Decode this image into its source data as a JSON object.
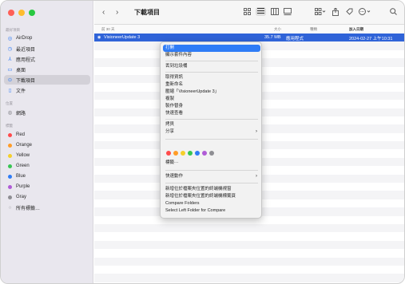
{
  "window": {
    "traffic_colors": [
      "#fe5f57",
      "#febc2e",
      "#28c840"
    ]
  },
  "sidebar": {
    "section_favorites": "最好項目",
    "favorites": [
      {
        "label": "AirDrop",
        "icon": "airdrop-icon",
        "glyph": "◎"
      },
      {
        "label": "最近項目",
        "icon": "clock-icon",
        "glyph": "◷"
      },
      {
        "label": "應用程式",
        "icon": "applications-icon",
        "glyph": "⅄"
      },
      {
        "label": "桌面",
        "icon": "desktop-icon",
        "glyph": "▭"
      },
      {
        "label": "下載項目",
        "icon": "downloads-icon",
        "glyph": "⊙"
      },
      {
        "label": "文件",
        "icon": "document-icon",
        "glyph": "▯"
      }
    ],
    "section_locations": "位置",
    "locations": [
      {
        "label": "網路",
        "icon": "network-icon",
        "glyph": "◍"
      }
    ],
    "section_tags": "標籤",
    "tags": [
      {
        "label": "Red",
        "color": "#ff4b4b"
      },
      {
        "label": "Orange",
        "color": "#ff9c27"
      },
      {
        "label": "Yellow",
        "color": "#f5cf2a"
      },
      {
        "label": "Green",
        "color": "#38c552"
      },
      {
        "label": "Blue",
        "color": "#2f7cf6"
      },
      {
        "label": "Purple",
        "color": "#b05bd6"
      },
      {
        "label": "Gray",
        "color": "#8e8e93"
      }
    ],
    "all_tags": "所有標籤…"
  },
  "toolbar": {
    "back": "‹",
    "forward": "›",
    "title": "下載項目"
  },
  "columns": {
    "group": "前 30 天",
    "size": "大小",
    "kind": "種類",
    "date_added": "加入日期"
  },
  "file": {
    "name": "VisioneerUpdate 3",
    "size": "35.7 MB",
    "kind": "應用程式",
    "date": "2024-02-27 上午10:31"
  },
  "context_menu": {
    "items": [
      {
        "label": "打開",
        "highlighted": true
      },
      {
        "label": "顯示套件內容"
      },
      {
        "label": "丟到垃圾桶"
      },
      {
        "label": "取得資訊"
      },
      {
        "label": "重新命名"
      },
      {
        "label": "壓縮「VisioneerUpdate 3」"
      },
      {
        "label": "複製"
      },
      {
        "label": "製作替身"
      },
      {
        "label": "快速查看"
      },
      {
        "label": "拷貝"
      },
      {
        "label": "分享",
        "submenu": true
      },
      {
        "label": "標籤⋯"
      },
      {
        "label": "快速動作",
        "submenu": true
      },
      {
        "label": "新增位於檔案夾位置的終端機視窗"
      },
      {
        "label": "新增位於檔案夾位置的終端機標籤頁"
      },
      {
        "label": "Compare Folders"
      },
      {
        "label": "Select Left Folder for Compare"
      }
    ],
    "tag_colors": [
      "#ff4b4b",
      "#ff9c27",
      "#f5cf2a",
      "#38c552",
      "#2f7cf6",
      "#b05bd6",
      "#8e8e93"
    ],
    "submenu_arrow": "›"
  }
}
